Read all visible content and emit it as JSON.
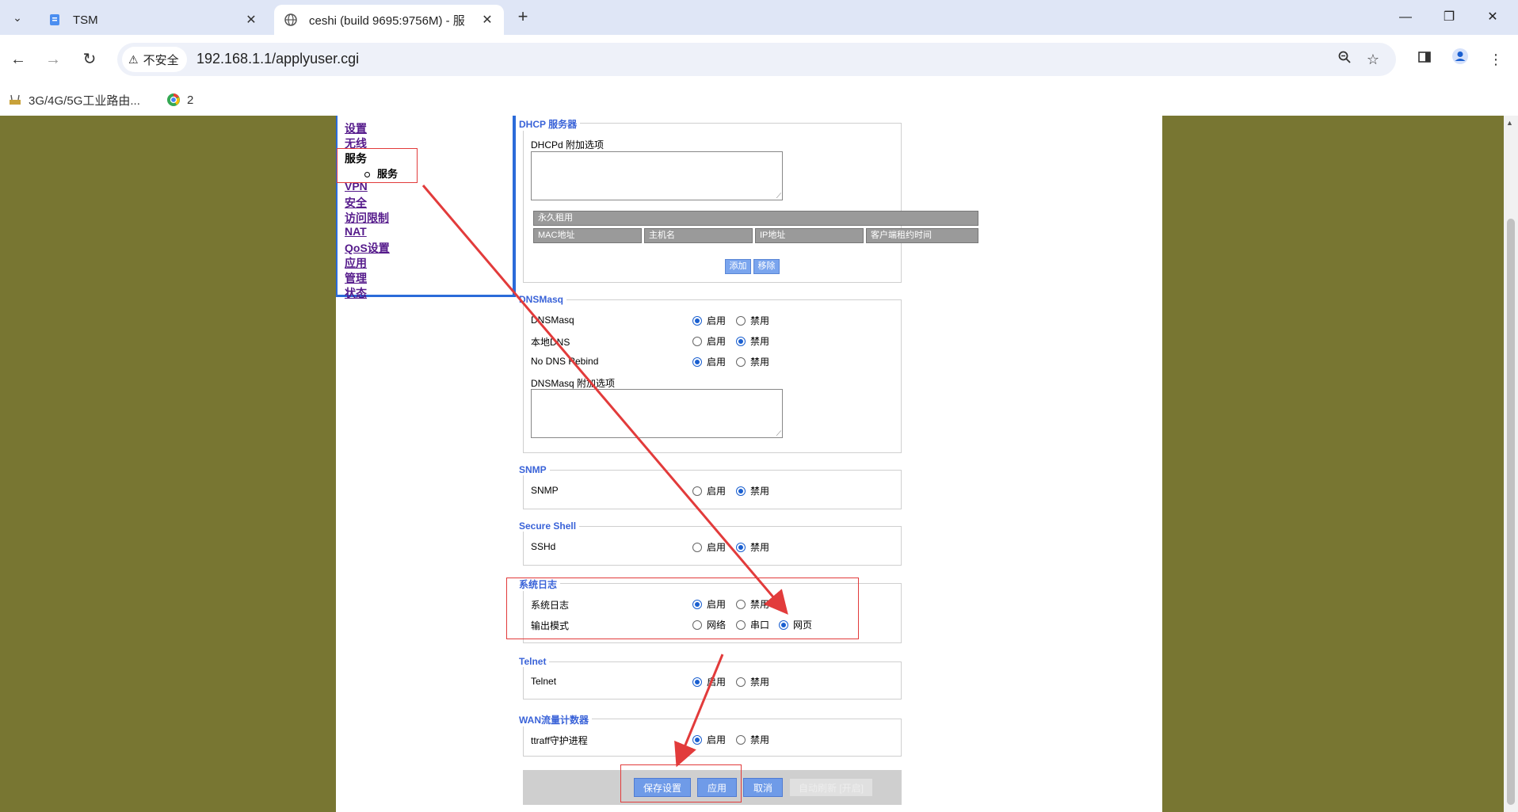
{
  "browser": {
    "tabs": [
      {
        "title": "TSM"
      },
      {
        "title": "ceshi (build 9695:9756M) - 服"
      }
    ],
    "security_label": "不安全",
    "url": "192.168.1.1/applyuser.cgi",
    "bookmarks": [
      {
        "label": "3G/4G/5G工业路由..."
      },
      {
        "label": "2"
      }
    ]
  },
  "menu": {
    "items": [
      "设置",
      "无线",
      "服务",
      "VPN",
      "安全",
      "访问限制",
      "NAT",
      "QoS设置",
      "应用",
      "管理",
      "状态"
    ],
    "current": "服务",
    "sub_item": "服务"
  },
  "dhcp": {
    "title": "DHCP 服务器",
    "option_label": "DHCPd 附加选项",
    "lease_title": "永久租用",
    "columns": [
      "MAC地址",
      "主机名",
      "IP地址",
      "客户端租约时间"
    ],
    "add_label": "添加",
    "remove_label": "移除"
  },
  "dnsmasq": {
    "title": "DNSMasq",
    "rows": [
      {
        "label": "DNSMasq",
        "enable": "启用",
        "disable": "禁用",
        "selected": "enable"
      },
      {
        "label": "本地DNS",
        "enable": "启用",
        "disable": "禁用",
        "selected": "disable"
      },
      {
        "label": "No DNS Rebind",
        "enable": "启用",
        "disable": "禁用",
        "selected": "enable"
      }
    ],
    "option_label": "DNSMasq 附加选项"
  },
  "snmp": {
    "title": "SNMP",
    "label": "SNMP",
    "enable": "启用",
    "disable": "禁用",
    "selected": "disable"
  },
  "ssh": {
    "title": "Secure Shell",
    "label": "SSHd",
    "enable": "启用",
    "disable": "禁用",
    "selected": "disable"
  },
  "syslog": {
    "title": "系统日志",
    "label": "系统日志",
    "enable": "启用",
    "disable": "禁用",
    "selected": "enable",
    "output_label": "输出模式",
    "output_options": [
      "网络",
      "串口",
      "网页"
    ],
    "output_selected": "网页"
  },
  "telnet": {
    "title": "Telnet",
    "label": "Telnet",
    "enable": "启用",
    "disable": "禁用",
    "selected": "enable"
  },
  "wan": {
    "title": "WAN流量计数器",
    "label": "ttraff守护进程",
    "enable": "启用",
    "disable": "禁用",
    "selected": "enable"
  },
  "footer": {
    "save_label": "保存设置",
    "apply_label": "应用",
    "cancel_label": "取消",
    "auto_refresh_label": "自动刷新 [开启]"
  },
  "colors": {
    "page_bg": "#787632",
    "menu_border": "#2b6bd9",
    "section_title": "#3a63d8",
    "annotation": "#e23b3b"
  }
}
